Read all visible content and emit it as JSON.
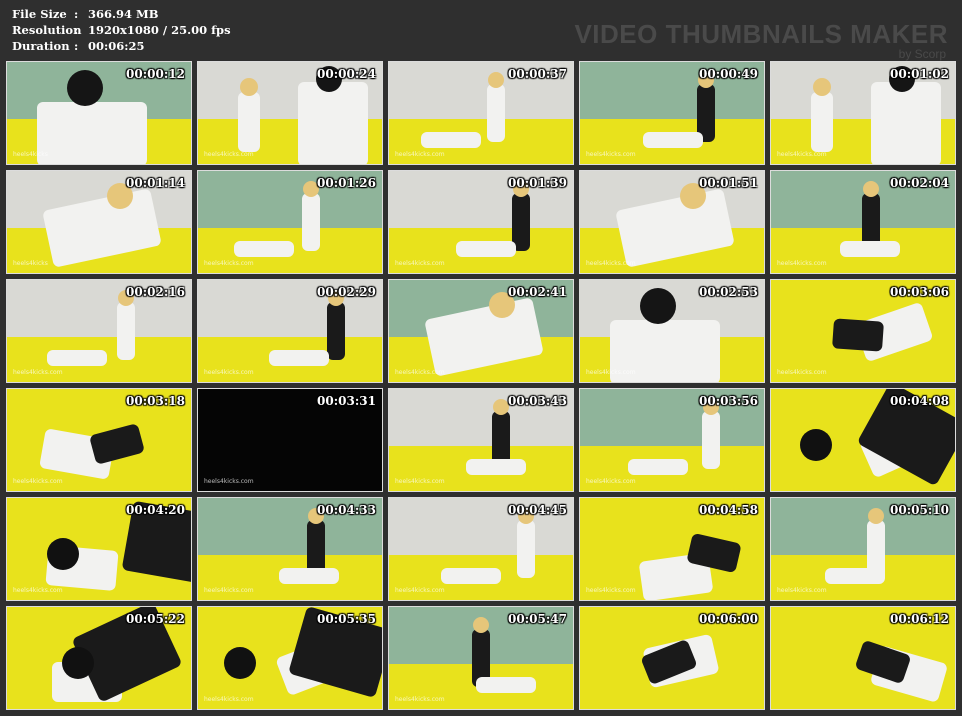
{
  "header": {
    "labels": {
      "file_size": "File Size",
      "resolution": "Resolution",
      "duration": "Duration"
    },
    "separator": ":",
    "values": {
      "file_size": "366.94 MB",
      "resolution": "1920x1080 / 25.00 fps",
      "duration": "00:06:25"
    }
  },
  "brand": {
    "title": "VIDEO THUMBNAILS MAKER",
    "subtitle": "by Scorp"
  },
  "thumbnails": [
    {
      "time": "00:00:12",
      "watermark": "heels4kicks",
      "scene": "dark-close"
    },
    {
      "time": "00:00:24",
      "watermark": "heels4kicks.com",
      "scene": "mixed"
    },
    {
      "time": "00:00:37",
      "watermark": "heels4kicks.com",
      "scene": "room"
    },
    {
      "time": "00:00:49",
      "watermark": "heels4kicks.com",
      "scene": "room"
    },
    {
      "time": "00:01:02",
      "watermark": "heels4kicks.com",
      "scene": "mixed"
    },
    {
      "time": "00:01:14",
      "watermark": "heels4kicks",
      "scene": "close-white"
    },
    {
      "time": "00:01:26",
      "watermark": "heels4kicks.com",
      "scene": "room"
    },
    {
      "time": "00:01:39",
      "watermark": "heels4kicks.com",
      "scene": "room"
    },
    {
      "time": "00:01:51",
      "watermark": "heels4kicks.com",
      "scene": "close-white"
    },
    {
      "time": "00:02:04",
      "watermark": "heels4kicks.com",
      "scene": "room"
    },
    {
      "time": "00:02:16",
      "watermark": "heels4kicks.com",
      "scene": "room"
    },
    {
      "time": "00:02:29",
      "watermark": "heels4kicks.com",
      "scene": "room"
    },
    {
      "time": "00:02:41",
      "watermark": "heels4kicks.com",
      "scene": "close-white"
    },
    {
      "time": "00:02:53",
      "watermark": "heels4kicks.com",
      "scene": "dark-close"
    },
    {
      "time": "00:03:06",
      "watermark": "heels4kicks.com",
      "scene": "yellow"
    },
    {
      "time": "00:03:18",
      "watermark": "heels4kicks.com",
      "scene": "yellow"
    },
    {
      "time": "00:03:31",
      "watermark": "heels4kicks.com",
      "scene": "black"
    },
    {
      "time": "00:03:43",
      "watermark": "heels4kicks.com",
      "scene": "room"
    },
    {
      "time": "00:03:56",
      "watermark": "heels4kicks.com",
      "scene": "room"
    },
    {
      "time": "00:04:08",
      "watermark": "",
      "scene": "yellow-dark"
    },
    {
      "time": "00:04:20",
      "watermark": "heels4kicks.com",
      "scene": "yellow-dark"
    },
    {
      "time": "00:04:33",
      "watermark": "heels4kicks.com",
      "scene": "room"
    },
    {
      "time": "00:04:45",
      "watermark": "heels4kicks.com",
      "scene": "room"
    },
    {
      "time": "00:04:58",
      "watermark": "heels4kicks.com",
      "scene": "yellow"
    },
    {
      "time": "00:05:10",
      "watermark": "heels4kicks.com",
      "scene": "room"
    },
    {
      "time": "00:05:22",
      "watermark": "",
      "scene": "yellow-dark"
    },
    {
      "time": "00:05:35",
      "watermark": "heels4kicks.com",
      "scene": "yellow-dark"
    },
    {
      "time": "00:05:47",
      "watermark": "heels4kicks.com",
      "scene": "room"
    },
    {
      "time": "00:06:00",
      "watermark": "",
      "scene": "yellow"
    },
    {
      "time": "00:06:12",
      "watermark": "",
      "scene": "yellow"
    }
  ],
  "colors": {
    "background": "#2f2f2f",
    "mat_yellow": "#e8e21c",
    "wall_light": "#d9d9d4",
    "wall_green": "#8fb49a",
    "gi_white": "#f2f2f0",
    "tights_black": "#1a1a1a"
  }
}
